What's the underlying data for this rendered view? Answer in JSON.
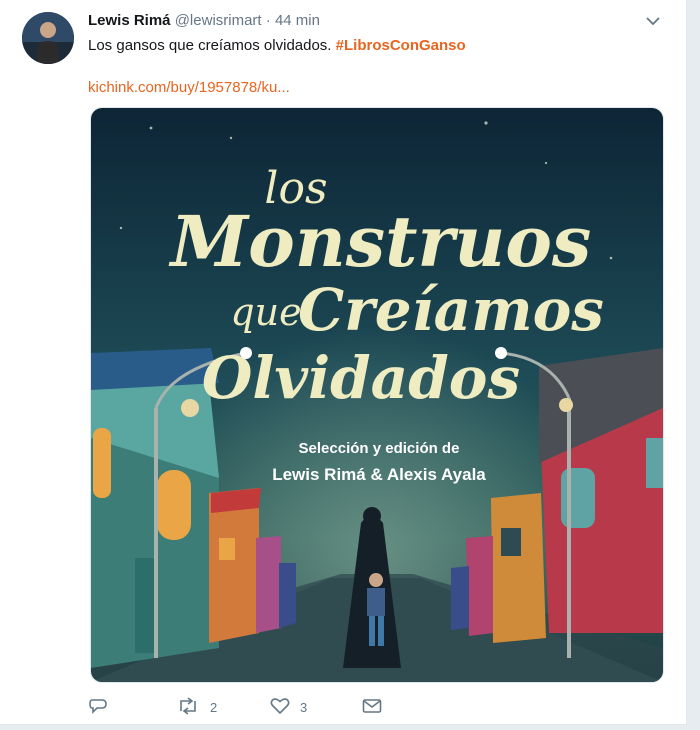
{
  "tweet": {
    "name": "Lewis Rimá",
    "handle": "@lewisrimart",
    "separator": "·",
    "time": "44 min",
    "text": "Los gansos que creíamos olvidados.",
    "hashtag": "#LibrosConGanso",
    "link": "kichink.com/buy/1957878/ku..."
  },
  "cover": {
    "title_line1": "los",
    "title_line2": "Monstruos",
    "title_line3a": "que",
    "title_line3b": "Creíamos",
    "title_line4": "Olvidados",
    "credit_line1": "Selección y edición de",
    "credit_line2": "Lewis Rimá & Alexis Ayala"
  },
  "actions": {
    "reply_count": "",
    "retweet_count": "2",
    "like_count": "3"
  },
  "colors": {
    "accent": "#e8651f",
    "muted": "#657786",
    "cover_title": "#eeecc0"
  }
}
